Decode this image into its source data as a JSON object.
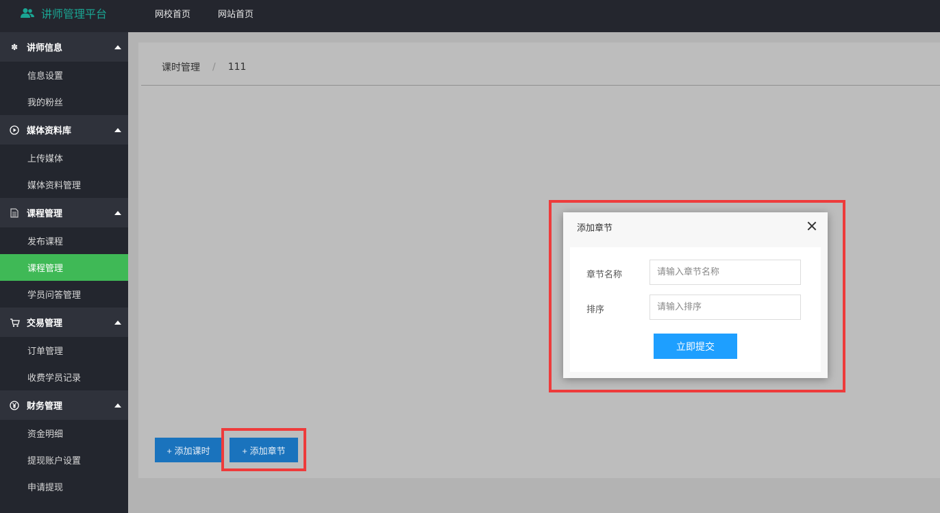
{
  "header": {
    "brand": "讲师管理平台",
    "nav": [
      "网校首页",
      "网站首页"
    ]
  },
  "sidebar": {
    "groups": [
      {
        "label": "讲师信息",
        "icon": "gear-icon",
        "items": [
          "信息设置",
          "我的粉丝"
        ]
      },
      {
        "label": "媒体资料库",
        "icon": "play-circle-icon",
        "items": [
          "上传媒体",
          "媒体资料管理"
        ]
      },
      {
        "label": "课程管理",
        "icon": "document-icon",
        "items": [
          "发布课程",
          "课程管理",
          "学员问答管理"
        ]
      },
      {
        "label": "交易管理",
        "icon": "cart-icon",
        "items": [
          "订单管理",
          "收费学员记录"
        ]
      },
      {
        "label": "财务管理",
        "icon": "yen-circle-icon",
        "items": [
          "资金明细",
          "提现账户设置",
          "申请提现"
        ]
      }
    ],
    "active_item": "课程管理"
  },
  "breadcrumb": {
    "items": [
      "课时管理",
      "111"
    ],
    "separator": "/"
  },
  "actions": {
    "add_lesson": "+ 添加课时",
    "add_chapter": "+ 添加章节"
  },
  "modal": {
    "title": "添加章节",
    "fields": [
      {
        "label": "章节名称",
        "placeholder": "请输入章节名称",
        "value": ""
      },
      {
        "label": "排序",
        "placeholder": "请输入排序",
        "value": ""
      }
    ],
    "submit": "立即提交"
  },
  "colors": {
    "topbar": "#24262e",
    "sidebar": "#23262e",
    "active": "#3fb956",
    "brand": "#1aa593",
    "highlight": "#ee3b3b",
    "submit": "#1e9fff"
  }
}
